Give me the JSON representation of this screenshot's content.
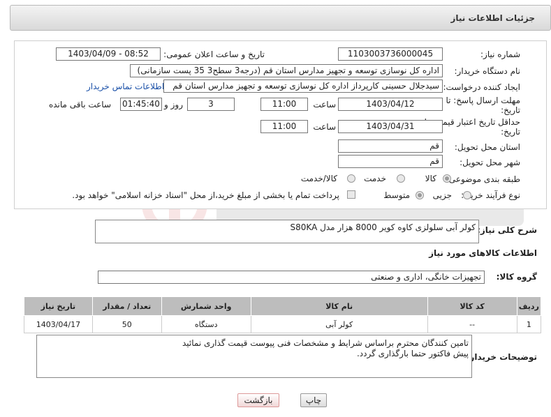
{
  "header": {
    "title": "جزئیات اطلاعات نیاز"
  },
  "form": {
    "need_number_label": "شماره نیاز:",
    "need_number": "1103003736000045",
    "announce_label": "تاریخ و ساعت اعلان عمومی:",
    "announce_value": "1403/04/09 - 08:52",
    "buyer_label": "نام دستگاه خریدار:",
    "buyer_value": "اداره کل نوسازی   توسعه و تجهیز مدارس استان قم (درجه3 سطح3  35 پست سازمانی)",
    "creator_label": "ایجاد کننده درخواست:",
    "creator_value": "سیدجلال حسینی کارپرداز اداره کل نوسازی   توسعه و تجهیز مدارس استان قم",
    "contact_link": "اطلاعات تماس خریدار",
    "deadline_label_1": "مهلت ارسال پاسخ: تا",
    "deadline_label_2": "تاریخ:",
    "deadline_date": "1403/04/12",
    "time_word": "ساعت",
    "deadline_time": "11:00",
    "days_value": "3",
    "days_word": "روز و",
    "remaining_value": "01:45:40",
    "remaining_word": "ساعت باقی مانده",
    "validity_label_1": "حداقل تاریخ اعتبار قیمت: تا",
    "validity_label_2": "تاریخ:",
    "validity_date": "1403/04/31",
    "validity_time": "11:00",
    "province_label": "استان محل تحویل:",
    "province_value": "قم",
    "city_label": "شهر محل تحویل:",
    "city_value": "قم",
    "category_label": "طبقه بندی موضوعی:",
    "category_options": [
      "کالا",
      "خدمت",
      "کالا/خدمت"
    ],
    "process_label": "نوع فرآیند خرید :",
    "process_options": [
      "جزیی",
      "متوسط"
    ],
    "payment_text": "پرداخت تمام یا بخشی از مبلغ خرید،از محل \"اسناد خزانه اسلامی\" خواهد بود."
  },
  "summary": {
    "label": "شرح کلی نیاز:",
    "value": "کولر آبی سلولزی کاوه کویر 8000 هزار مدل S80KA"
  },
  "goods_info": {
    "title": "اطلاعات کالاهای مورد نیاز"
  },
  "goods_group": {
    "label": "گروه کالا:",
    "value": "تجهیزات خانگی، اداری و صنعتی"
  },
  "table": {
    "headers": [
      "ردیف",
      "کد کالا",
      "نام کالا",
      "واحد شمارش",
      "تعداد / مقدار",
      "تاریخ نیاز"
    ],
    "rows": [
      [
        "1",
        "--",
        "کولر آبی",
        "دستگاه",
        "50",
        "1403/04/17"
      ]
    ]
  },
  "buyer_notes": {
    "label": "توضیحات خریدار:",
    "line1": "تامین کنندگان محترم براساس شرایط و مشخصات فنی پیوست قیمت گذاری نمائید",
    "line2": "پیش فاکتور حتما بارگذاری گردد."
  },
  "buttons": {
    "print": "چاپ",
    "back": "بازگشت"
  },
  "colors": {
    "link": "#1a50a8",
    "header_bg": "#e6e6e6",
    "table_header": "#bdbdbd"
  }
}
